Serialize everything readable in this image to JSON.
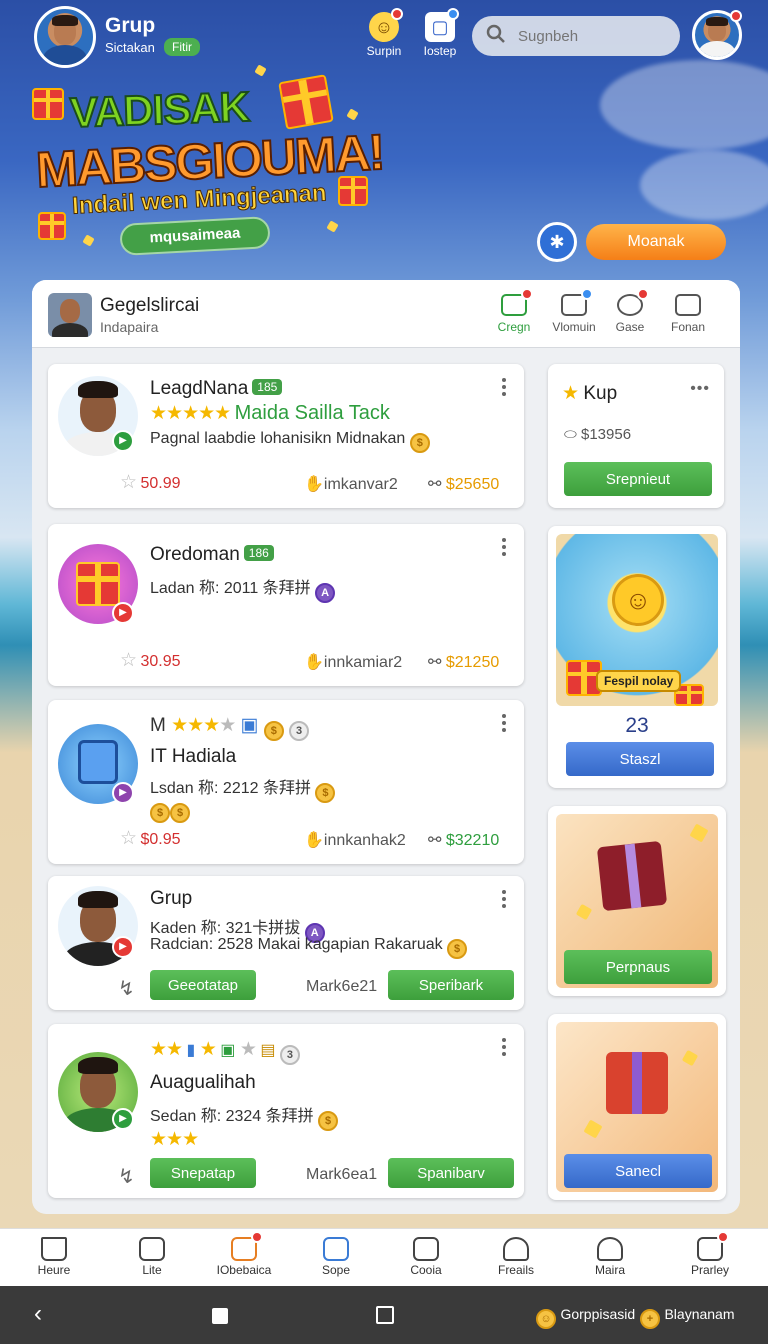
{
  "header": {
    "title": "Grup",
    "subtitle": "Sictakan",
    "badge": "Fitir",
    "icons": [
      {
        "label": "Surpin",
        "icon": "coin-icon"
      },
      {
        "label": "Iostep",
        "icon": "tablet-icon"
      }
    ],
    "search_placeholder": "Sugnbeh"
  },
  "banner": {
    "line1": "VADISAK",
    "line2": "MABSGIOUMA!",
    "line3": "Indail wen Mingjeanan",
    "pill": "mqusaimeaa",
    "button": "Moanak"
  },
  "panel": {
    "title": "Gegelslircai",
    "subtitle": "Indapaira",
    "tabs": [
      {
        "label": "Cregn",
        "active": true
      },
      {
        "label": "Vlomuin",
        "active": false
      },
      {
        "label": "Gase",
        "active": false
      },
      {
        "label": "Fonan",
        "active": false
      }
    ]
  },
  "cards": [
    {
      "name": "LeagdNana",
      "level": "185",
      "tagline": "Maida Sailla Tack",
      "desc": "Pagnal laabdie lohanisikn Midnakan",
      "price": "50.99",
      "stat": "imkanvar2",
      "reward": "$25650"
    },
    {
      "name": "Oredoman",
      "level": "186",
      "desc": "Ladan 称: 2011 条拜拼",
      "price": "30.95",
      "stat": "innkamiar2",
      "reward": "$21250"
    },
    {
      "name": "M",
      "title": "IT Hadiala",
      "badge_num": "3",
      "desc": "Lsdan 称: 2212 条拜拼",
      "price": "$0.95",
      "stat": "innkanhak2",
      "reward": "$32210"
    },
    {
      "name": "Grup",
      "desc": "Kaden 称: 321卡拼拔",
      "desc2": "Radcian: 2528 Makai kagapian Rakaruak",
      "btn_left": "Geeotatap",
      "mid": "Mark6e21",
      "btn_right": "Speribark"
    },
    {
      "name": "Auagualihah",
      "badge_num": "3",
      "desc": "Sedan 称: 2324 条拜拼",
      "btn_left": "Snepatap",
      "mid": "Mark6ea1",
      "btn_right": "Spanibarv"
    }
  ],
  "side": {
    "kup": {
      "title": "Kup",
      "price": "$13956",
      "button": "Srepnieut"
    },
    "promo": {
      "art_label": "Fespil nolay",
      "count": "23",
      "button": "Staszl"
    },
    "gift1": {
      "button": "Perpnaus"
    },
    "gift2": {
      "button": "Sanecl"
    }
  },
  "bottom_nav": [
    {
      "label": "Heure",
      "icon": "home-icon"
    },
    {
      "label": "Lite",
      "icon": "building-icon"
    },
    {
      "label": "IObebaica",
      "icon": "gift-icon"
    },
    {
      "label": "Sope",
      "icon": "edit-icon"
    },
    {
      "label": "Cooia",
      "icon": "box-icon"
    },
    {
      "label": "Freails",
      "icon": "person-icon"
    },
    {
      "label": "Maira",
      "icon": "person-icon"
    },
    {
      "label": "Prarley",
      "icon": "hand-icon"
    }
  ],
  "system_bar": {
    "item1": "Gorppisasid",
    "item2": "Blaynanam"
  },
  "colors": {
    "accent_green": "#43a047",
    "accent_orange": "#f57f17",
    "accent_blue": "#3569c9"
  }
}
